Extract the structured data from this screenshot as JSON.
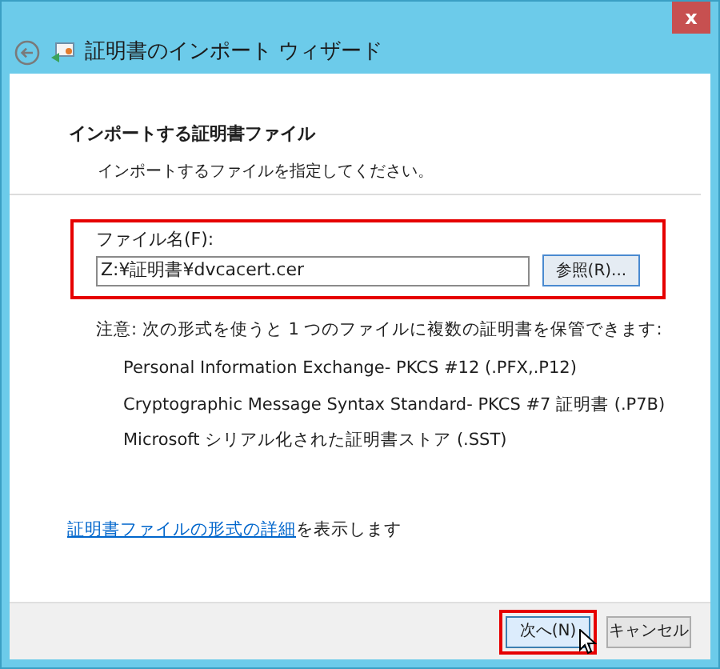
{
  "window": {
    "close_label": "x",
    "title": "証明書のインポート ウィザード"
  },
  "header": {
    "title": "インポートする証明書ファイル",
    "subtitle": "インポートするファイルを指定してください。"
  },
  "file_field": {
    "label": "ファイル名(F):",
    "value": "Z:¥証明書¥dvcacert.cer",
    "browse_button": "参照(R)...",
    "highlighted": true
  },
  "note": "注意: 次の形式を使うと 1 つのファイルに複数の証明書を保管できます:",
  "formats": [
    "Personal Information Exchange- PKCS #12 (.PFX,.P12)",
    "Cryptographic Message Syntax Standard- PKCS #7 証明書 (.P7B)",
    "Microsoft シリアル化された証明書ストア (.SST)"
  ],
  "more_info": {
    "link": "証明書ファイルの形式の詳細",
    "text": "を表示します"
  },
  "buttons": [
    {
      "label": "次へ(N)",
      "highlighted": true,
      "hovered": true
    },
    {
      "label": "キャンセル",
      "highlighted": false,
      "hovered": false
    }
  ]
}
